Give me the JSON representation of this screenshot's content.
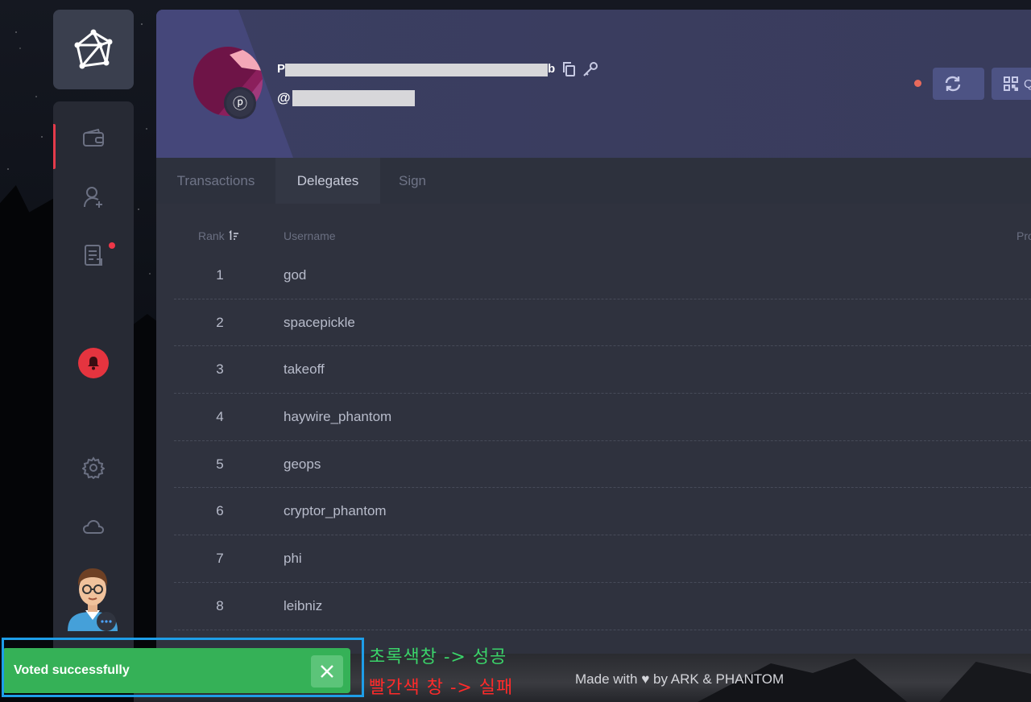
{
  "header": {
    "address_prefix": "P",
    "address_suffix": "b",
    "name_prefix": "@"
  },
  "tabs": [
    {
      "label": "Transactions"
    },
    {
      "label": "Delegates"
    },
    {
      "label": "Sign"
    }
  ],
  "header_buttons": {
    "qr_label": "Q"
  },
  "table": {
    "columns": {
      "rank": "Rank",
      "username": "Username",
      "productivity": "Pro"
    },
    "rows": [
      {
        "rank": "1",
        "username": "god"
      },
      {
        "rank": "2",
        "username": "spacepickle"
      },
      {
        "rank": "3",
        "username": "takeoff"
      },
      {
        "rank": "4",
        "username": "haywire_phantom"
      },
      {
        "rank": "5",
        "username": "geops"
      },
      {
        "rank": "6",
        "username": "cryptor_phantom"
      },
      {
        "rank": "7",
        "username": "phi"
      },
      {
        "rank": "8",
        "username": "leibniz"
      }
    ]
  },
  "footer": {
    "made_with": "Made with ♥ by ARK & PHANTOM"
  },
  "toast": {
    "message": "Voted successfully"
  },
  "annotations": {
    "green": "초록색창 -> 성공",
    "red": "빨간색 창 -> 실패"
  },
  "colors": {
    "toast_success": "#35b157",
    "accent_red": "#e43b4b",
    "header_bg": "#3b3e62"
  }
}
